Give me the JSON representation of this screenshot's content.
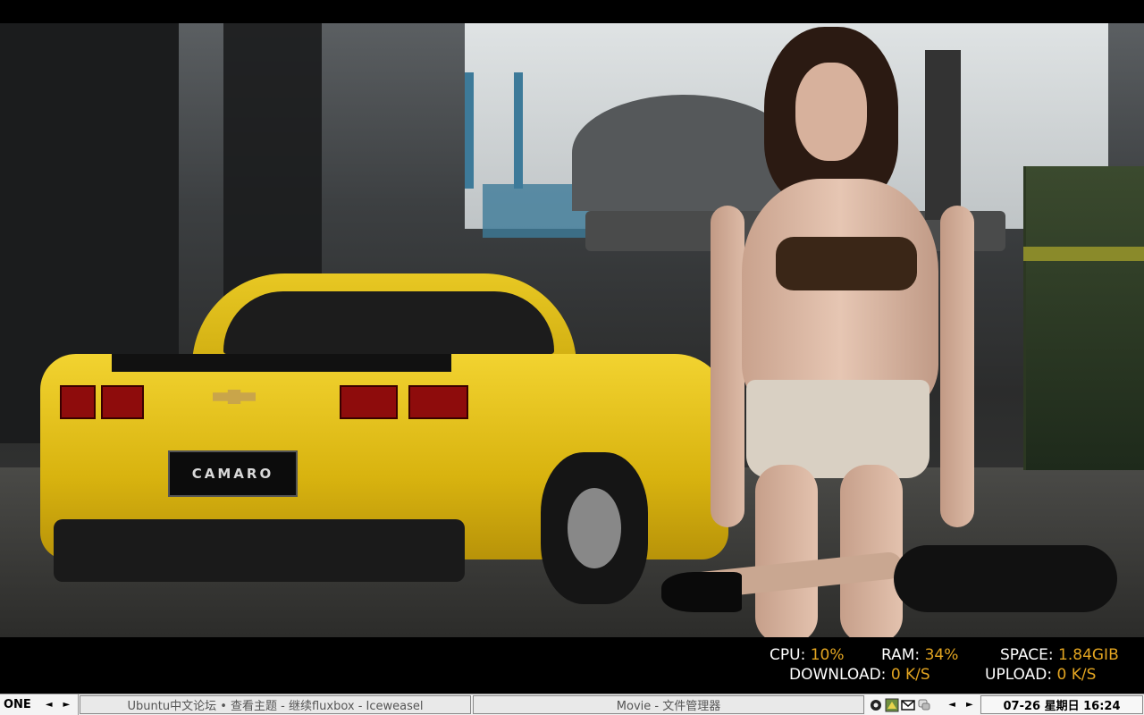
{
  "desktop": {
    "wallpaper": {
      "plate_text": "CAMARO"
    },
    "stats": {
      "cpu_label": "CPU:",
      "cpu_value": "10%",
      "ram_label": "RAM:",
      "ram_value": "34%",
      "space_label": "SPACE:",
      "space_value": "1.84GIB",
      "download_label": "DOWNLOAD:",
      "download_value": "0 K/S",
      "upload_label": "UPLOAD:",
      "upload_value": "0 K/S",
      "label_color": "#ffffff",
      "value_color": "#e3a521"
    }
  },
  "taskbar": {
    "workspace_name": "ONE",
    "prev_arrow": "◄",
    "next_arrow": "►",
    "tasks": [
      {
        "title": "Ubuntu中文论坛 • 查看主题 - 继续fluxbox - Iceweasel"
      },
      {
        "title": "Movie - 文件管理器"
      }
    ],
    "tray_icons": [
      "record-icon",
      "network-icon",
      "mail-icon",
      "chat-icon"
    ],
    "clock": "07-26 星期日 16:24"
  }
}
